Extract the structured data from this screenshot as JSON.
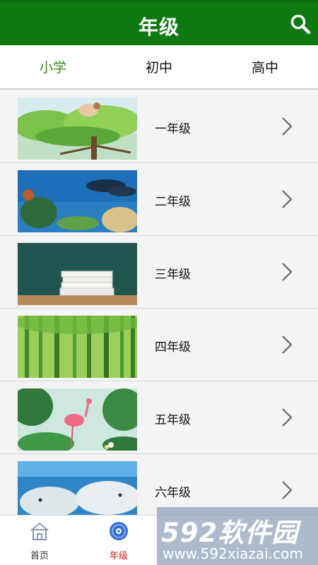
{
  "header": {
    "title": "年级",
    "search_icon": "search-icon"
  },
  "tabs": [
    {
      "label": "小学",
      "active": true
    },
    {
      "label": "初中",
      "active": false
    },
    {
      "label": "高中",
      "active": false
    }
  ],
  "grades": [
    {
      "label": "一年级",
      "image": "tree-fairy-illustration"
    },
    {
      "label": "二年级",
      "image": "underwater-dolphins"
    },
    {
      "label": "三年级",
      "image": "books-on-desk"
    },
    {
      "label": "四年级",
      "image": "bamboo-forest"
    },
    {
      "label": "五年级",
      "image": "flamingo-leaves"
    },
    {
      "label": "六年级",
      "image": "beluga-whales"
    }
  ],
  "footer": {
    "items": [
      {
        "label": "首页",
        "icon": "home-icon",
        "active": false
      },
      {
        "label": "年级",
        "icon": "disc-icon",
        "active": true
      }
    ]
  },
  "watermark": {
    "top": "592软件园",
    "bottom": "www.592xiazai.com"
  },
  "colors": {
    "header_bg": "#0f7a12",
    "active_tab": "#2e8b1a",
    "active_nav": "#d4201a"
  }
}
